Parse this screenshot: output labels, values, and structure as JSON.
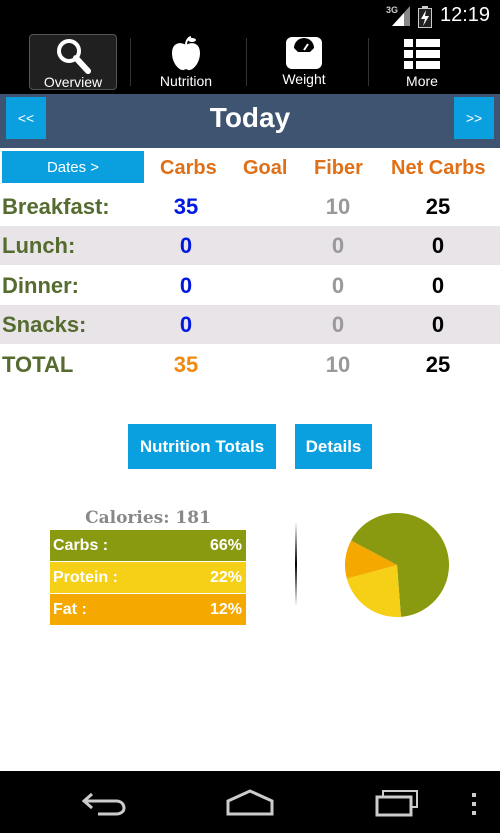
{
  "status": {
    "network": "3G",
    "time": "12:19"
  },
  "tabs": [
    {
      "label": "Overview",
      "icon": "search-icon",
      "active": true
    },
    {
      "label": "Nutrition",
      "icon": "apple-icon",
      "active": false
    },
    {
      "label": "Weight",
      "icon": "scale-icon",
      "active": false
    },
    {
      "label": "More",
      "icon": "list-icon",
      "active": false
    }
  ],
  "day": {
    "prev": "<<",
    "title": "Today",
    "next": ">>"
  },
  "table": {
    "dates_button": "Dates >",
    "headers": {
      "carbs": "Carbs",
      "goal": "Goal",
      "fiber": "Fiber",
      "net": "Net Carbs"
    },
    "rows": [
      {
        "meal": "Breakfast:",
        "carbs": "35",
        "goal": "",
        "fiber": "10",
        "net": "25"
      },
      {
        "meal": "Lunch:",
        "carbs": "0",
        "goal": "",
        "fiber": "0",
        "net": "0"
      },
      {
        "meal": "Dinner:",
        "carbs": "0",
        "goal": "",
        "fiber": "0",
        "net": "0"
      },
      {
        "meal": "Snacks:",
        "carbs": "0",
        "goal": "",
        "fiber": "0",
        "net": "0"
      },
      {
        "meal": "TOTAL",
        "carbs": "35",
        "goal": "",
        "fiber": "10",
        "net": "25"
      }
    ]
  },
  "buttons": {
    "nutrition_totals": "Nutrition Totals",
    "details": "Details"
  },
  "summary": {
    "calories_label": "Calories: 181",
    "macros": [
      {
        "name": "Carbs :",
        "pct": "66%",
        "value": 66,
        "color": "#8a9a10"
      },
      {
        "name": "Protein :",
        "pct": "22%",
        "value": 22,
        "color": "#f5d016"
      },
      {
        "name": "Fat :",
        "pct": "12%",
        "value": 12,
        "color": "#f5a800"
      }
    ]
  },
  "colors": {
    "accent": "#0aa0e0",
    "header_bar": "#3e5470",
    "column_header": "#e07018",
    "meal_label": "#556b2f"
  }
}
